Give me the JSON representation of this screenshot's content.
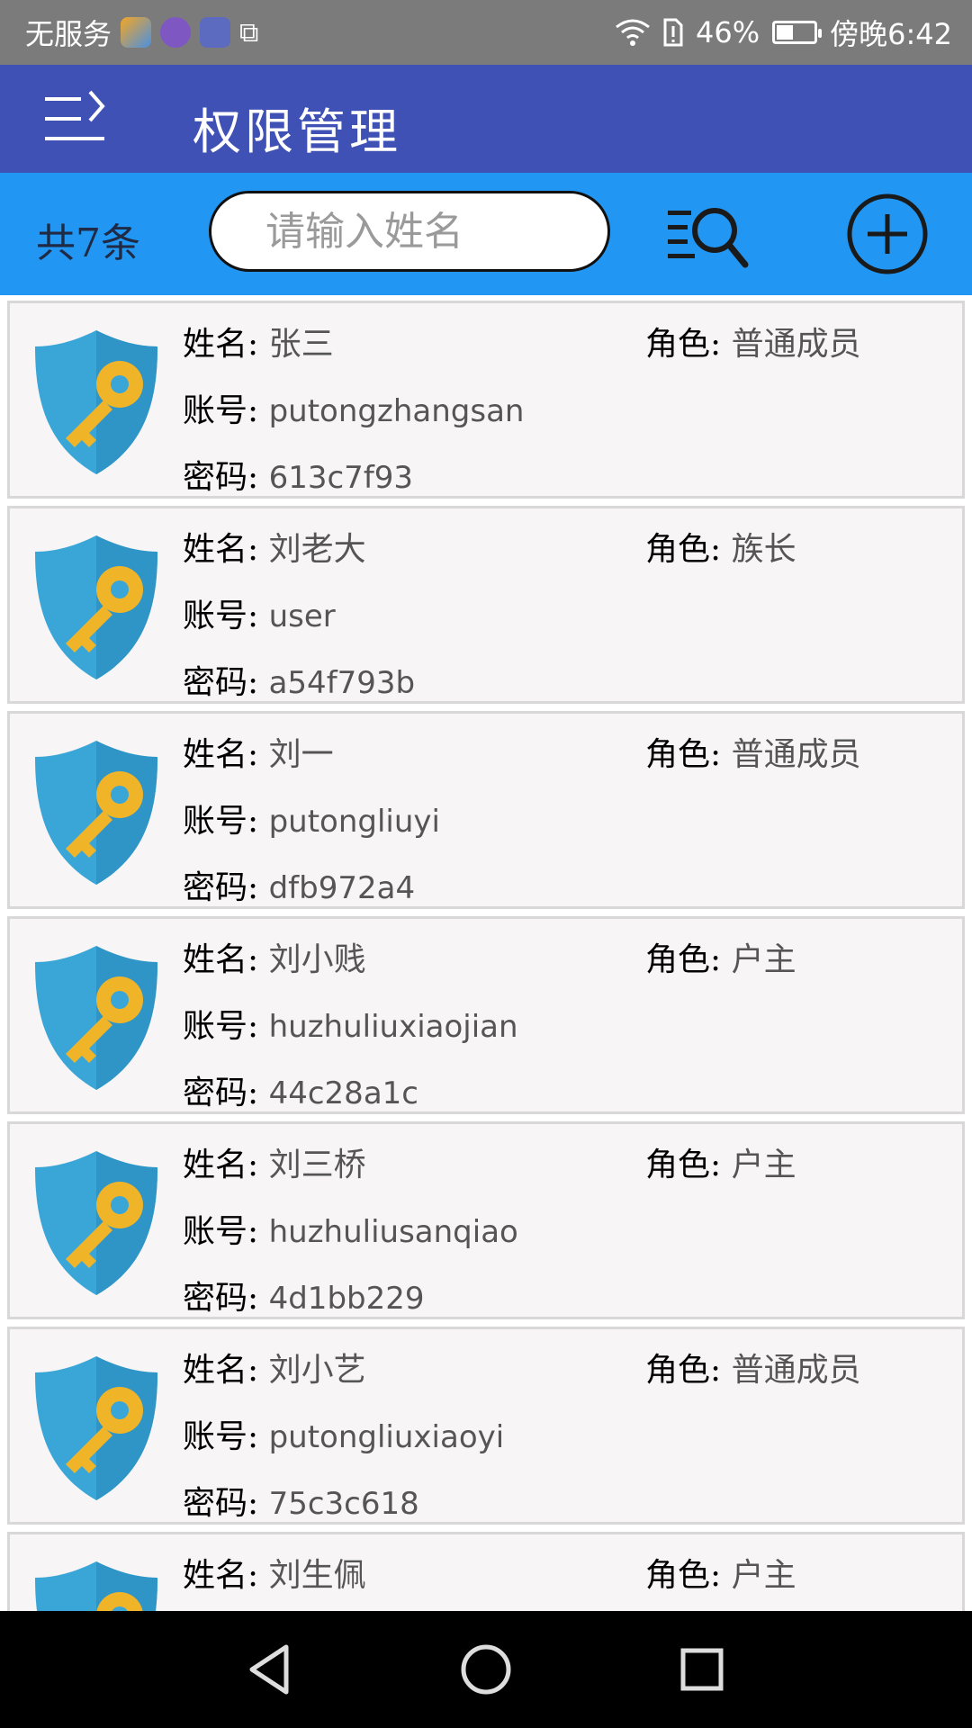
{
  "status_bar": {
    "carrier": "无服务",
    "battery_percent": "46%",
    "time": "傍晚6:42"
  },
  "app_bar": {
    "title": "权限管理"
  },
  "toolbar": {
    "count_label": "共7条",
    "search_placeholder": "请输入姓名"
  },
  "labels": {
    "name": "姓名:",
    "account": "账号:",
    "password": "密码:",
    "role": "角色:"
  },
  "users": [
    {
      "name": "张三",
      "account": "putongzhangsan",
      "password": "613c7f93",
      "role": "普通成员"
    },
    {
      "name": "刘老大",
      "account": "user",
      "password": "a54f793b",
      "role": "族长"
    },
    {
      "name": "刘一",
      "account": "putongliuyi",
      "password": "dfb972a4",
      "role": "普通成员"
    },
    {
      "name": "刘小贱",
      "account": "huzhuliuxiaojian",
      "password": "44c28a1c",
      "role": "户主"
    },
    {
      "name": "刘三桥",
      "account": "huzhuliusanqiao",
      "password": "4d1bb229",
      "role": "户主"
    },
    {
      "name": "刘小艺",
      "account": "putongliuxiaoyi",
      "password": "75c3c618",
      "role": "普通成员"
    },
    {
      "name": "刘生佩",
      "account": "",
      "password": "",
      "role": "户主"
    }
  ],
  "colors": {
    "app_bar": "#3f51b5",
    "toolbar": "#2196f3",
    "shield": "#3aa6d8",
    "key": "#f0b429"
  }
}
